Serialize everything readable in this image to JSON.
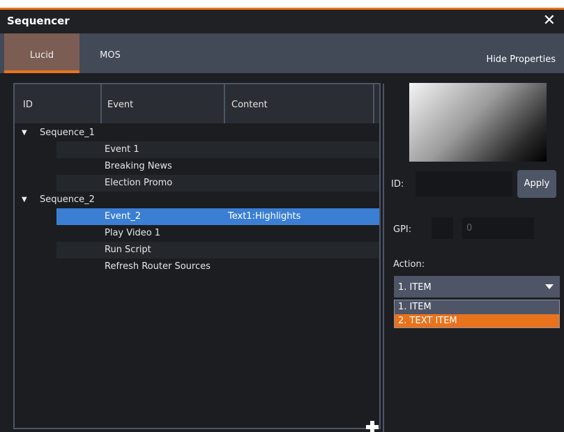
{
  "window": {
    "title": "Sequencer",
    "close_symbol": "✕"
  },
  "tabs": {
    "lucid": "Lucid",
    "mos": "MOS",
    "hide_properties": "Hide Properties"
  },
  "table": {
    "columns": {
      "id": "ID",
      "event": "Event",
      "content": "Content"
    },
    "groups": [
      {
        "label": "Sequence_1",
        "events": [
          {
            "event": "Event 1",
            "content": ""
          },
          {
            "event": "Breaking News",
            "content": ""
          },
          {
            "event": "Election Promo",
            "content": ""
          }
        ]
      },
      {
        "label": "Sequence_2",
        "events": [
          {
            "event": "Event_2",
            "content": "Text1:Highlights",
            "selected": true
          },
          {
            "event": "Play Video 1",
            "content": ""
          },
          {
            "event": "Run Script",
            "content": ""
          },
          {
            "event": "Refresh Router Sources",
            "content": ""
          }
        ]
      }
    ]
  },
  "properties": {
    "id_label": "ID:",
    "id_value": "",
    "apply_label": "Apply",
    "gpi_label": "GPI:",
    "gpi_value": "0",
    "action_label": "Action:",
    "action_selected": "1. ITEM",
    "action_options": [
      "1. ITEM",
      "2. TEXT ITEM"
    ],
    "action_highlighted_index": 1
  },
  "colors": {
    "accent": "#e9731d",
    "selection": "#3b7fd5",
    "tab_active": "#7c5d54",
    "tabbar": "#424957",
    "background": "#1c1e22"
  },
  "icons": {
    "expand": "caret-down-icon",
    "add": "plus-icon",
    "close": "close-icon",
    "dropdown": "chevron-down-icon"
  }
}
